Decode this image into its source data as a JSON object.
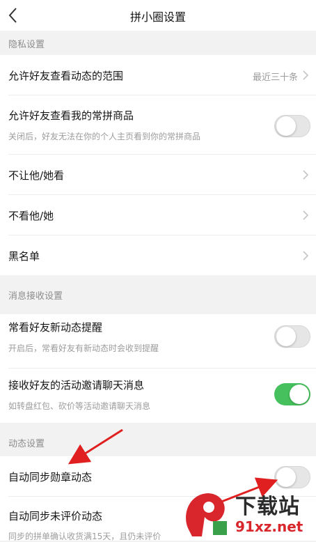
{
  "header": {
    "title": "拼小圈设置"
  },
  "sections": [
    {
      "header": "隐私设置",
      "rows": [
        {
          "title": "允许好友查看动态的范围",
          "value": "最近三十条"
        },
        {
          "title": "允许好友查看我的常拼商品",
          "subtitle": "关闭后，好友无法在你的个人主页看到你的常拼商品",
          "toggle": "off"
        },
        {
          "title": "不让他/她看"
        },
        {
          "title": "不看他/她"
        },
        {
          "title": "黑名单"
        }
      ]
    },
    {
      "header": "消息接收设置",
      "rows": [
        {
          "title": "常看好友新动态提醒",
          "subtitle": "开启后，常看好友有新动态时会收到提醒",
          "toggle": "off"
        },
        {
          "title": "接收好友的活动邀请聊天消息",
          "subtitle": "如转盘红包、砍价等活动邀请聊天消息",
          "toggle": "on"
        }
      ]
    },
    {
      "header": "动态设置",
      "rows": [
        {
          "title": "自动同步勋章动态",
          "toggle": "off"
        },
        {
          "title": "自动同步未评价动态",
          "subtitle": "同步的拼单确认收货满15天，且仍未评价"
        }
      ]
    }
  ],
  "watermark": {
    "title": "下载站",
    "url": "91xz.net"
  },
  "colors": {
    "toggle_on": "#46c05c",
    "annotation_arrow": "#e02020",
    "watermark_url": "#d9262c"
  }
}
